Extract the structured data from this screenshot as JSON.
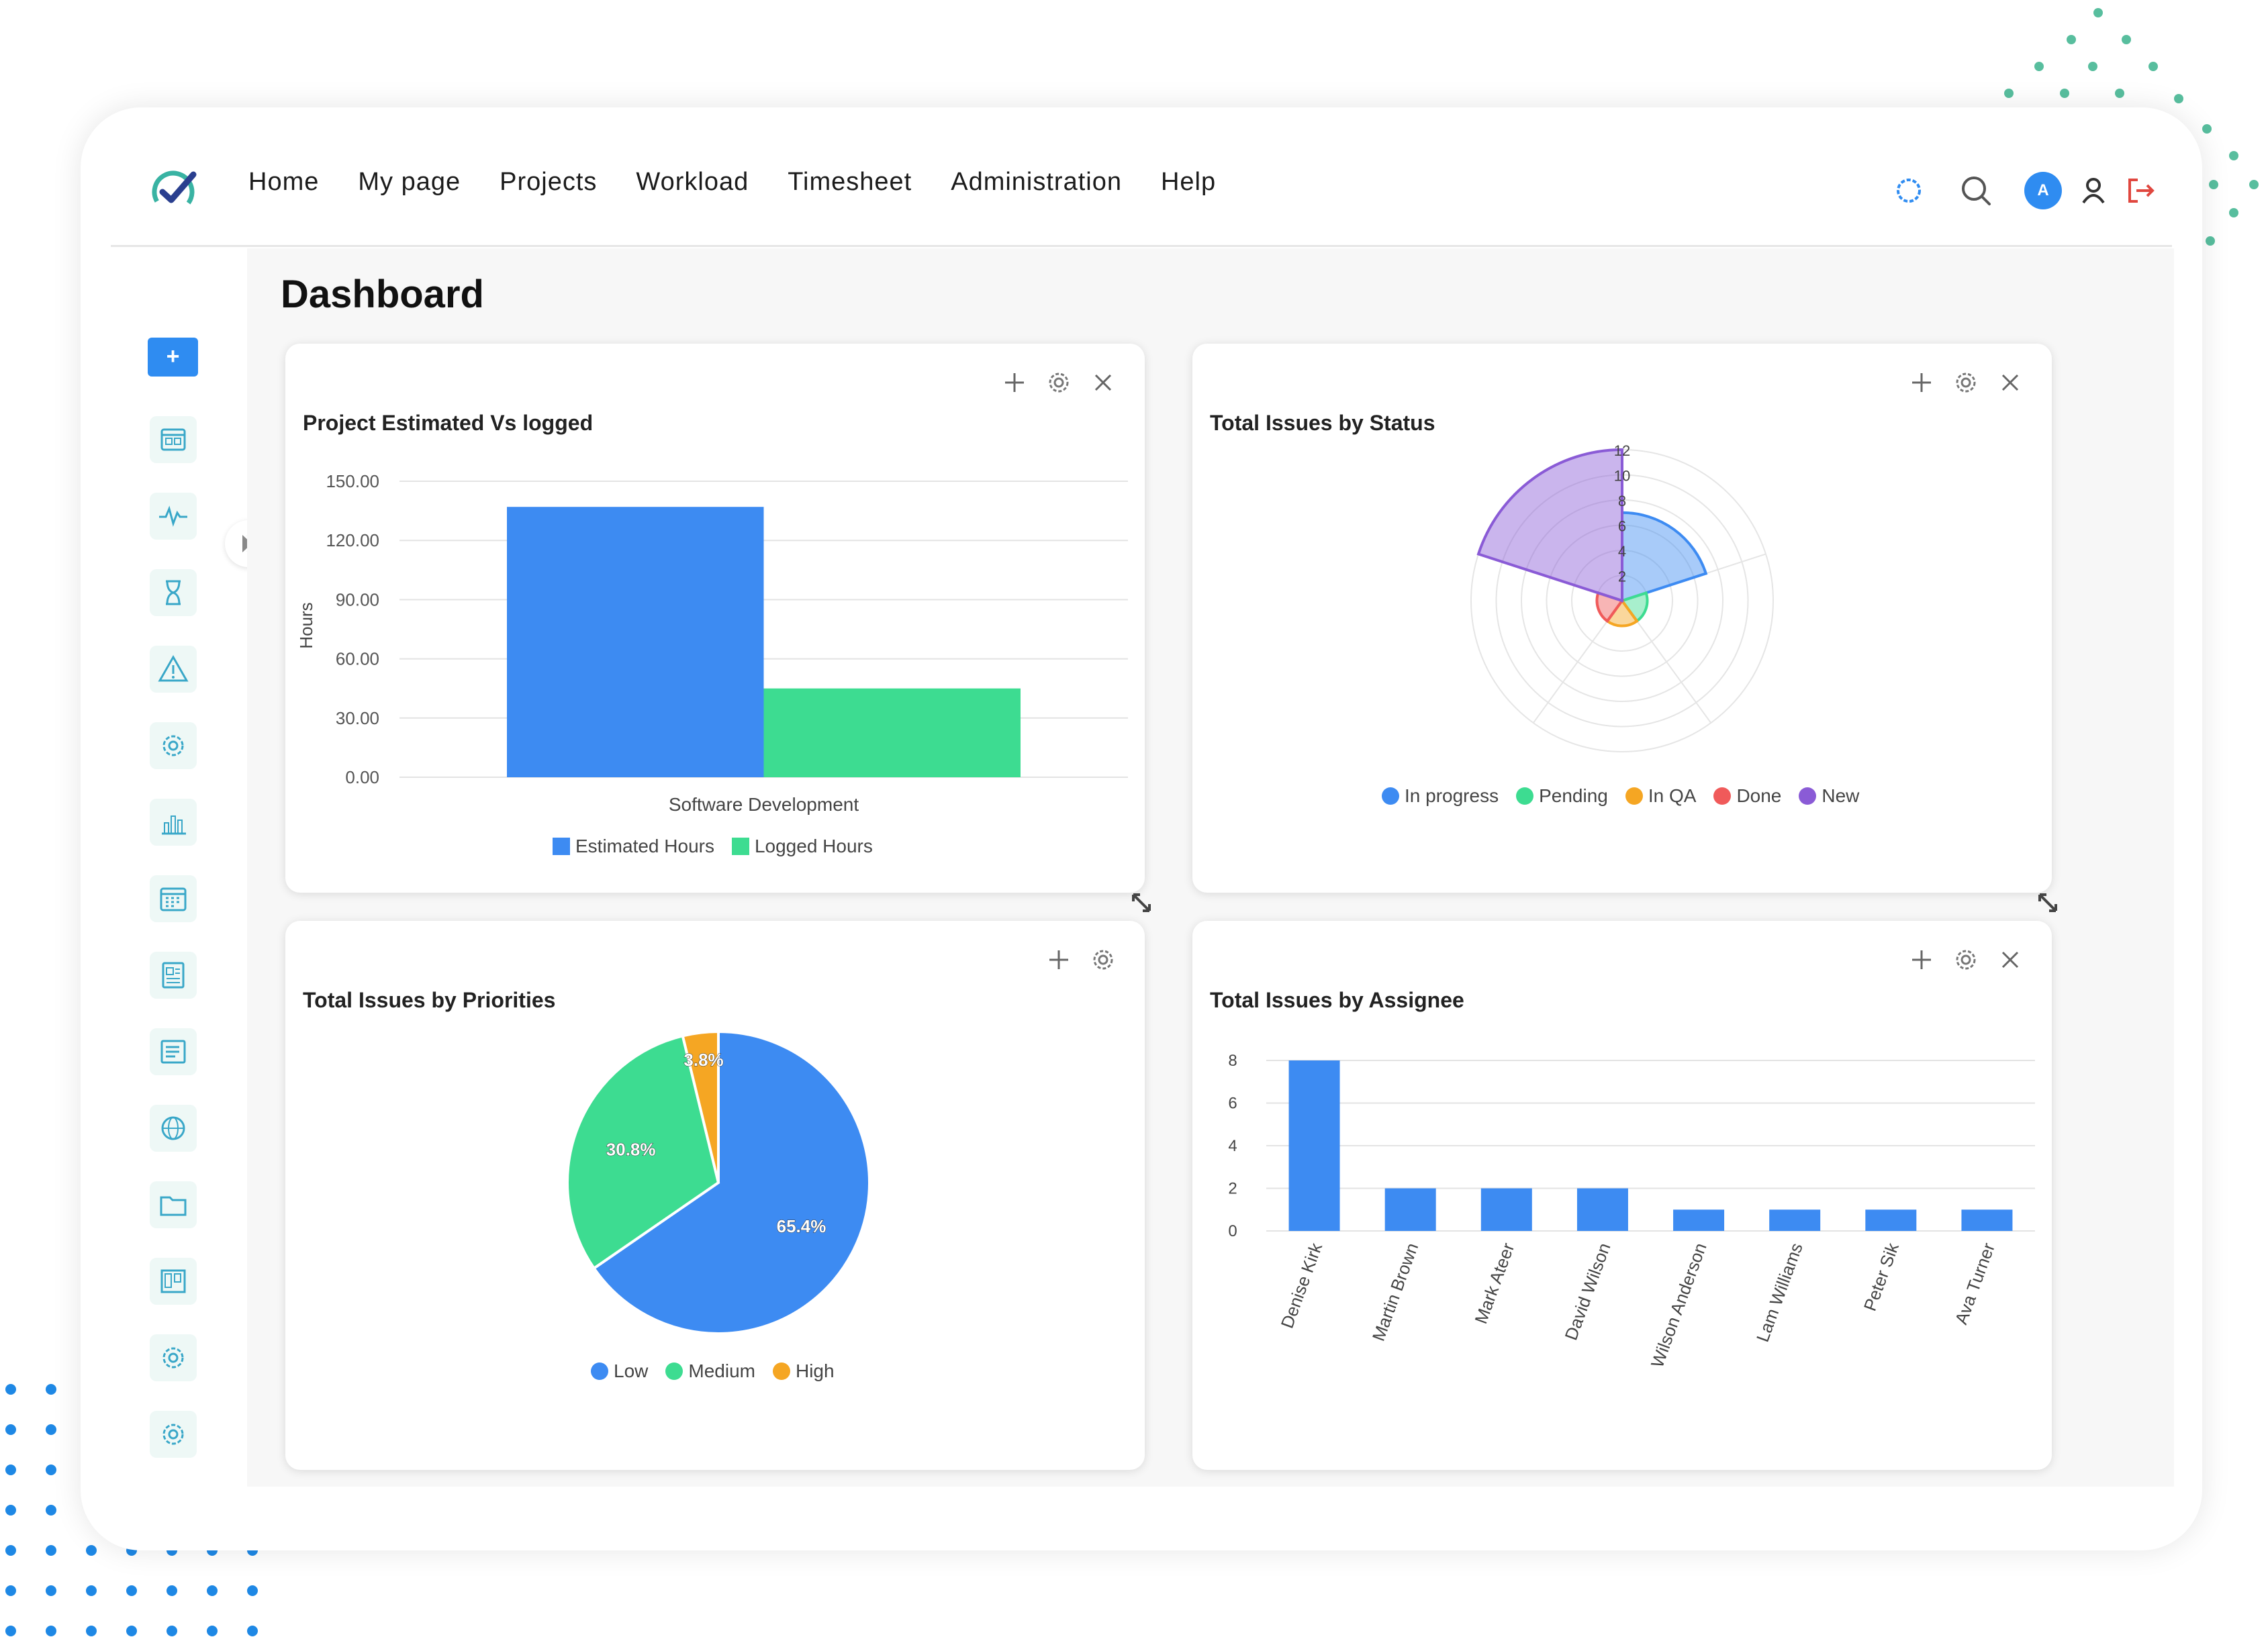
{
  "nav": {
    "items": [
      "Home",
      "My page",
      "Projects",
      "Workload",
      "Timesheet",
      "Administration",
      "Help"
    ],
    "avatar_initial": "A"
  },
  "page": {
    "title": "Dashboard"
  },
  "sidebar": {
    "add_label": "+",
    "icons": [
      "calendar-icon",
      "activity-icon",
      "hourglass-icon",
      "warning-icon",
      "gear-icon",
      "chart-icon",
      "calendar-grid-icon",
      "document-icon",
      "list-icon",
      "globe-icon",
      "folder-icon",
      "board-icon",
      "gear-icon",
      "gear-icon"
    ]
  },
  "colors": {
    "blue": "#3d8bf2",
    "green": "#3ddc91",
    "orange": "#f5a623",
    "red": "#f05a5a",
    "purple": "#8a5bd6"
  },
  "cards": {
    "estimated": {
      "title": "Project Estimated Vs logged"
    },
    "status": {
      "title": "Total Issues by Status"
    },
    "priorities": {
      "title": "Total Issues by Priorities"
    },
    "assignee": {
      "title": "Total Issues by Assignee"
    }
  },
  "chart_data": [
    {
      "type": "bar",
      "title": "Project Estimated Vs logged",
      "categories": [
        "Software Development"
      ],
      "ylabel": "Hours",
      "ylim": [
        0,
        150
      ],
      "yticks": [
        "150.00",
        "120.00",
        "90.00",
        "60.00",
        "30.00",
        "0.00"
      ],
      "series": [
        {
          "name": "Estimated Hours",
          "values": [
            137
          ],
          "color": "#3d8bf2"
        },
        {
          "name": "Logged Hours",
          "values": [
            45
          ],
          "color": "#3ddc91"
        }
      ],
      "legend": "bottom"
    },
    {
      "type": "polar-area",
      "title": "Total Issues by Status",
      "rmax": 12,
      "rticks": [
        "12",
        "10",
        "8",
        "6",
        "4",
        "2"
      ],
      "categories": [
        "In progress",
        "Pending",
        "In QA",
        "Done",
        "New"
      ],
      "values": [
        7,
        2,
        2,
        2,
        12
      ],
      "colors": [
        "#3d8bf2",
        "#3ddc91",
        "#f5a623",
        "#f05a5a",
        "#8a5bd6"
      ],
      "legend": "bottom"
    },
    {
      "type": "pie",
      "title": "Total Issues by Priorities",
      "categories": [
        "Low",
        "Medium",
        "High"
      ],
      "values": [
        65.4,
        30.8,
        3.8
      ],
      "labels": [
        "65.4%",
        "30.8%",
        "3.8%"
      ],
      "colors": [
        "#3d8bf2",
        "#3ddc91",
        "#f5a623"
      ],
      "legend": "bottom"
    },
    {
      "type": "bar",
      "title": "Total Issues by Assignee",
      "categories": [
        "Denise Kirk",
        "Martin Brown",
        "Mark Ateer",
        "David Wilson",
        "Wilson Anderson",
        "Lam Williams",
        "Peter Sik",
        "Ava Turner"
      ],
      "values": [
        8,
        2,
        2,
        2,
        1,
        1,
        1,
        1
      ],
      "ylim": [
        0,
        8
      ],
      "yticks": [
        "8",
        "6",
        "4",
        "2",
        "0"
      ],
      "color": "#3d8bf2"
    }
  ]
}
